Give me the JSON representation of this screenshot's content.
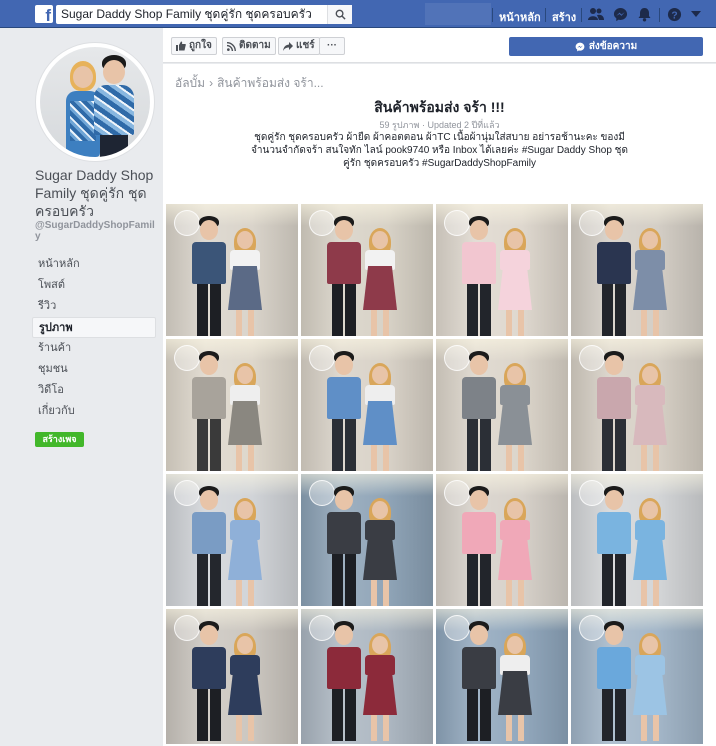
{
  "topbar": {
    "search_value": "Sugar Daddy Shop Family ชุดคู่รัก ชุดครอบครัว",
    "home_label": "หน้าหลัก",
    "create_label": "สร้าง"
  },
  "page": {
    "name": "Sugar Daddy Shop Family ชุดคู่รัก ชุดครอบครัว",
    "handle": "@SugarDaddyShopFamily"
  },
  "menu": [
    {
      "label": "หน้าหลัก",
      "active": false
    },
    {
      "label": "โพสต์",
      "active": false
    },
    {
      "label": "รีวิว",
      "active": false
    },
    {
      "label": "รูปภาพ",
      "active": true
    },
    {
      "label": "ร้านค้า",
      "active": false
    },
    {
      "label": "ชุมชน",
      "active": false
    },
    {
      "label": "วิดีโอ",
      "active": false
    },
    {
      "label": "เกี่ยวกับ",
      "active": false
    }
  ],
  "create_page_label": "สร้างเพจ",
  "actions": {
    "like": "ถูกใจ",
    "follow": "ติดตาม",
    "share": "แชร์",
    "more": "···",
    "send_message": "ส่งข้อความ"
  },
  "album": {
    "breadcrumb_root": "อัลบั้ม",
    "breadcrumb_current": "สินค้าพร้อมส่ง จร้า...",
    "title": "สินค้าพร้อมส่ง จร้า !!!",
    "meta": "59 รูปภาพ · Updated 2 ปีที่แล้ว",
    "description": "ชุดคู่รัก ชุดครอบครัว ผ้ายืด ผ้าคอตตอน ผ้าTC เนื้อผ้านุ่มใส่สบาย อย่ารอช้านะคะ ของมีจำนวนจำกัดจร้า สนใจทัก ไลน์ pook9740 หรือ Inbox ได้เลยค่ะ #Sugar Daddy Shop ชุดคู่รัก ชุดครอบครัว #SugarDaddyShopFamily"
  },
  "colors": {
    "brand": "#4267b2",
    "create_green": "#42b72a"
  },
  "photos": [
    {
      "name": "couple-photo-1",
      "bg": "#d8d2c8",
      "man_top": "#3b5578",
      "man_pants": "#1d1f24",
      "woman_top": "#f2f2f2",
      "woman_dress": "#5b6a86"
    },
    {
      "name": "couple-photo-2",
      "bg": "#d6d0c4",
      "man_top": "#8e3a4a",
      "man_pants": "#1d1f24",
      "woman_top": "#f2f2f2",
      "woman_dress": "#8e3a4a"
    },
    {
      "name": "couple-photo-3",
      "bg": "#ddd6cc",
      "man_top": "#f2c6d0",
      "man_pants": "#22252b",
      "woman_top": "#f5d3dc",
      "woman_dress": "#f5d3dc"
    },
    {
      "name": "couple-photo-4",
      "bg": "#d2ccc3",
      "man_top": "#2a3550",
      "man_pants": "#22252b",
      "woman_top": "#7d8ea8",
      "woman_dress": "#7d8ea8"
    },
    {
      "name": "couple-photo-5",
      "bg": "#dcd5c9",
      "man_top": "#a8a39b",
      "man_pants": "#3a3a3a",
      "woman_top": "#eeeeee",
      "woman_dress": "#8a8780"
    },
    {
      "name": "couple-photo-6",
      "bg": "#d7d0c5",
      "man_top": "#5f8fc7",
      "man_pants": "#2b2f36",
      "woman_top": "#eeeeee",
      "woman_dress": "#5f8fc7"
    },
    {
      "name": "couple-photo-7",
      "bg": "#dad3c8",
      "man_top": "#7d8288",
      "man_pants": "#2b2f36",
      "woman_top": "#8a9096",
      "woman_dress": "#8a9096"
    },
    {
      "name": "couple-photo-8",
      "bg": "#d5cec3",
      "man_top": "#c9a7ad",
      "man_pants": "#2b2f36",
      "woman_top": "#d8b9bd",
      "woman_dress": "#d8b9bd"
    },
    {
      "name": "couple-photo-9",
      "bg": "#cfd2d6",
      "man_top": "#7a9cc4",
      "man_pants": "#24272d",
      "woman_top": "#8fb0d8",
      "woman_dress": "#8fb0d8"
    },
    {
      "name": "couple-photo-10",
      "bg": "#8aa0b4",
      "man_top": "#3a3d44",
      "man_pants": "#1d1f24",
      "woman_top": "#3a3d44",
      "woman_dress": "#3a3d44"
    },
    {
      "name": "couple-photo-11",
      "bg": "#d5cfc7",
      "man_top": "#f0a8b8",
      "man_pants": "#22252b",
      "woman_top": "#f0a8b8",
      "woman_dress": "#f0a8b8"
    },
    {
      "name": "couple-photo-12",
      "bg": "#d2d4d6",
      "man_top": "#7ab4e0",
      "man_pants": "#22252b",
      "woman_top": "#7ab4e0",
      "woman_dress": "#7ab4e0"
    },
    {
      "name": "couple-photo-13",
      "bg": "#c9c4bd",
      "man_top": "#2e3d5c",
      "man_pants": "#1d1f24",
      "woman_top": "#2e3d5c",
      "woman_dress": "#2e3d5c"
    },
    {
      "name": "couple-photo-14",
      "bg": "#a9b4bf",
      "man_top": "#8c2a3a",
      "man_pants": "#1d1f24",
      "woman_top": "#8c2a3a",
      "woman_dress": "#8c2a3a"
    },
    {
      "name": "couple-photo-15",
      "bg": "#8da4ba",
      "man_top": "#3a3d44",
      "man_pants": "#1d1f24",
      "woman_top": "#eeeeee",
      "woman_dress": "#3a3d44"
    },
    {
      "name": "couple-photo-16",
      "bg": "#9fb3c6",
      "man_top": "#6aa8dc",
      "man_pants": "#22252b",
      "woman_top": "#9cc4e4",
      "woman_dress": "#9cc4e4"
    }
  ]
}
